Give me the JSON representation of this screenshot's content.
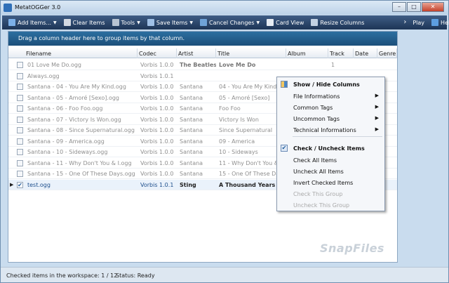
{
  "window": {
    "title": "MetatOGGer 3.0"
  },
  "window_buttons": [
    "–",
    "□",
    "✕"
  ],
  "toolbar": [
    {
      "label": "Add Items...",
      "icon": "add-icon",
      "dropdown": true,
      "color": "#7cb0e8"
    },
    {
      "label": "Clear Items",
      "icon": "clear-icon",
      "dropdown": false,
      "color": "#d3d9e2"
    },
    {
      "label": "Tools",
      "icon": "tools-icon",
      "dropdown": true,
      "color": "#b8c4d2"
    },
    {
      "label": "Save Items",
      "icon": "save-icon",
      "dropdown": true,
      "color": "#9fc0e6"
    },
    {
      "label": "Cancel Changes",
      "icon": "cancel-icon",
      "dropdown": true,
      "color": "#6fa3d8"
    },
    {
      "label": "Card View",
      "icon": "card-view-icon",
      "dropdown": false,
      "color": "#e6ecf3"
    },
    {
      "label": "Resize Columns",
      "icon": "resize-icon",
      "dropdown": false,
      "color": "#c3d2e4"
    },
    {
      "label": "Play",
      "icon": "play-icon",
      "dropdown": false,
      "color": "#ffffff",
      "prefix": "›"
    },
    {
      "label": "Help",
      "icon": "help-icon",
      "dropdown": true,
      "color": "#5d9ee0"
    }
  ],
  "group_panel": "Drag a column header here to group items by that column.",
  "columns": [
    "Filename",
    "Codec",
    "Artist",
    "Title",
    "Album",
    "Track",
    "Date",
    "Genre"
  ],
  "rows": [
    {
      "filename": "01 Love Me Do.ogg",
      "codec": "Vorbis 1.0.0",
      "artist": "The Beatles",
      "title": "Love Me Do",
      "album": "",
      "track": "1",
      "bold": true,
      "checked": false,
      "selected": false
    },
    {
      "filename": "Always.ogg",
      "codec": "Vorbis 1.0.1",
      "artist": "",
      "title": "",
      "album": "",
      "track": "",
      "bold": false,
      "checked": false,
      "selected": false
    },
    {
      "filename": "Santana - 04 - You Are My Kind.ogg",
      "codec": "Vorbis 1.0.0",
      "artist": "Santana",
      "title": "04 - You Are My Kind",
      "album": "",
      "track": "",
      "bold": false,
      "checked": false,
      "selected": false
    },
    {
      "filename": "Santana - 05 - Amoré [Sexo].ogg",
      "codec": "Vorbis 1.0.0",
      "artist": "Santana",
      "title": "05 - Amoré [Sexo]",
      "album": "",
      "track": "",
      "bold": false,
      "checked": false,
      "selected": false
    },
    {
      "filename": "Santana - 06 - Foo Foo.ogg",
      "codec": "Vorbis 1.0.0",
      "artist": "Santana",
      "title": "Foo Foo",
      "album": "",
      "track": "",
      "bold": false,
      "checked": false,
      "selected": false
    },
    {
      "filename": "Santana - 07 - Victory Is Won.ogg",
      "codec": "Vorbis 1.0.0",
      "artist": "Santana",
      "title": "Victory Is Won",
      "album": "",
      "track": "",
      "bold": false,
      "checked": false,
      "selected": false
    },
    {
      "filename": "Santana - 08 - Since Supernatural.ogg",
      "codec": "Vorbis 1.0.0",
      "artist": "Santana",
      "title": "Since Supernatural",
      "album": "",
      "track": "",
      "bold": false,
      "checked": false,
      "selected": false
    },
    {
      "filename": "Santana - 09 - America.ogg",
      "codec": "Vorbis 1.0.0",
      "artist": "Santana",
      "title": "09 - America",
      "album": "",
      "track": "",
      "bold": false,
      "checked": false,
      "selected": false
    },
    {
      "filename": "Santana - 10 - Sideways.ogg",
      "codec": "Vorbis 1.0.0",
      "artist": "Santana",
      "title": "10 - Sideways",
      "album": "",
      "track": "",
      "bold": false,
      "checked": false,
      "selected": false
    },
    {
      "filename": "Santana - 11 - Why Don't You & I.ogg",
      "codec": "Vorbis 1.0.0",
      "artist": "Santana",
      "title": "11 - Why Don't You & I",
      "album": "",
      "track": "",
      "bold": false,
      "checked": false,
      "selected": false
    },
    {
      "filename": "Santana - 15 - One Of These Days.ogg",
      "codec": "Vorbis 1.0.0",
      "artist": "Santana",
      "title": "15 - One Of These Days",
      "album": "",
      "track": "",
      "bold": false,
      "checked": false,
      "selected": false
    },
    {
      "filename": "test.ogg",
      "codec": "Vorbis 1.0.1",
      "artist": "Sting",
      "title": "A Thousand Years",
      "album": "",
      "track": "",
      "bold": true,
      "checked": true,
      "selected": true
    }
  ],
  "context_menu": {
    "items": [
      {
        "label": "Show / Hide Columns",
        "type": "header",
        "icon": "columns-icon"
      },
      {
        "label": "File Informations",
        "type": "submenu"
      },
      {
        "label": "Common Tags",
        "type": "submenu"
      },
      {
        "label": "Uncommon Tags",
        "type": "submenu"
      },
      {
        "label": "Technical Informations",
        "type": "submenu"
      },
      {
        "type": "separator"
      },
      {
        "label": "Check / Uncheck Items",
        "type": "header",
        "icon": "checkbox-icon"
      },
      {
        "label": "Check All Items",
        "type": "item"
      },
      {
        "label": "Uncheck All Items",
        "type": "item"
      },
      {
        "label": "Invert Checked Items",
        "type": "item"
      },
      {
        "label": "Check This Group",
        "type": "disabled"
      },
      {
        "label": "Uncheck This Group",
        "type": "disabled"
      }
    ]
  },
  "watermark": "SnapFiles",
  "status": {
    "checked_label": "Checked items in the workspace:",
    "checked_value": "1 / 12",
    "status_label": "Status:",
    "status_value": "Ready"
  }
}
